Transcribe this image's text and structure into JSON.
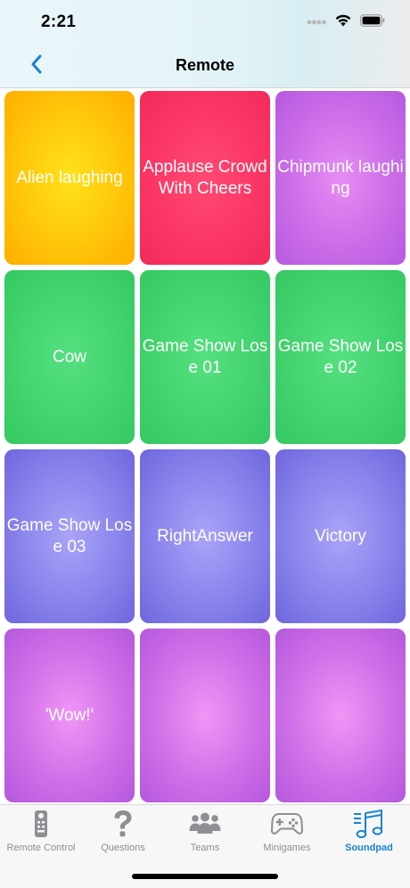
{
  "status_bar": {
    "time": "2:21",
    "icons": [
      "signal-dots-icon",
      "wifi-icon",
      "battery-icon"
    ]
  },
  "nav": {
    "title": "Remote",
    "back_icon": "chevron-left-icon"
  },
  "sounds": [
    {
      "label": "Alien laughing",
      "color": "#ffc20a"
    },
    {
      "label": "Applause Crowd With Cheers",
      "color": "#f93563"
    },
    {
      "label": "Chipmunk laughing",
      "color": "#cc6ee8"
    },
    {
      "label": "Cow",
      "color": "#43d36f"
    },
    {
      "label": "Game Show Lose 01",
      "color": "#43d36f"
    },
    {
      "label": "Game Show Lose 02",
      "color": "#43d36f"
    },
    {
      "label": "Game Show Lose 03",
      "color": "#8a83ec"
    },
    {
      "label": "RightAnswer",
      "color": "#8a83ec"
    },
    {
      "label": "Victory",
      "color": "#8a83ec"
    },
    {
      "label": "'Wow!'",
      "color": "#d06fe8"
    },
    {
      "label": "",
      "color": "#d06fe8"
    },
    {
      "label": "",
      "color": "#d06fe8"
    }
  ],
  "tabs": [
    {
      "label": "Remote Control",
      "icon": "remote-control-icon",
      "active": false
    },
    {
      "label": "Questions",
      "icon": "question-mark-icon",
      "active": false
    },
    {
      "label": "Teams",
      "icon": "people-icon",
      "active": false
    },
    {
      "label": "Minigames",
      "icon": "gamepad-icon",
      "active": false
    },
    {
      "label": "Soundpad",
      "icon": "music-note-icon",
      "active": true
    }
  ],
  "colors": {
    "accent": "#1a82d6",
    "tab_inactive": "#8e8e93"
  }
}
